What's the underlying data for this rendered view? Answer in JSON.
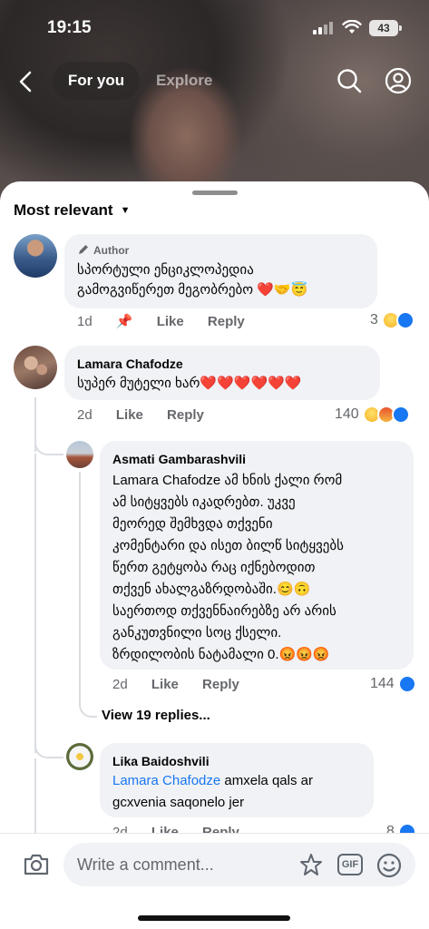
{
  "status": {
    "time": "19:15",
    "battery": "43"
  },
  "nav": {
    "tab_active": "For you",
    "tab_other": "Explore"
  },
  "sort_label": "Most relevant",
  "comments": [
    {
      "author_badge": "Author",
      "text_line1": "სპორტული ენციკლოპედია",
      "text_line2": "გამოგვიწერეთ მეგობრებო ❤️🤝😇",
      "time": "1d",
      "like": "Like",
      "reply": "Reply",
      "reaction_count": "3"
    },
    {
      "name": "Lamara Chafodze",
      "text": "სუპერ მუტელი ხარ❤️❤️❤️❤️❤️❤️",
      "time": "2d",
      "like": "Like",
      "reply": "Reply",
      "reaction_count": "140"
    },
    {
      "name": "Asmati Gambarashvili",
      "lines": [
        "Lamara Chafodze ამ ხნის ქალი რომ",
        "ამ სიტყვებს იკადრებთ. უკვე",
        "მეორედ შემხვდა თქვენი",
        "კომენტარი და ისეთ ბილწ სიტყვებს",
        "წერთ გეტყობა რაც იქნებოდით",
        "თქვენ ახალგაზრდობაში.😊🙃",
        "საერთოდ თქვენნაირებზე არ არის",
        "განკუთვნილი სოც ქსელი.",
        "ზრდილობის ნატამალი 0.😡😡😡"
      ],
      "time": "2d",
      "like": "Like",
      "reply": "Reply",
      "reaction_count": "144"
    },
    {
      "name": "Lika Baidoshvili",
      "mention": "Lamara Chafodze",
      "text_rest": " amxela qals ar",
      "text_line2": "gcxvenia saqonelo jer",
      "time": "2d",
      "like": "Like",
      "reply": "Reply",
      "reaction_count": "8"
    }
  ],
  "view_replies": "View 19 replies...",
  "composer": {
    "placeholder": "Write a comment...",
    "gif_label": "GIF"
  },
  "colors": {
    "accent": "#1877f2",
    "bubble": "#f0f2f5",
    "meta": "#65676b"
  }
}
